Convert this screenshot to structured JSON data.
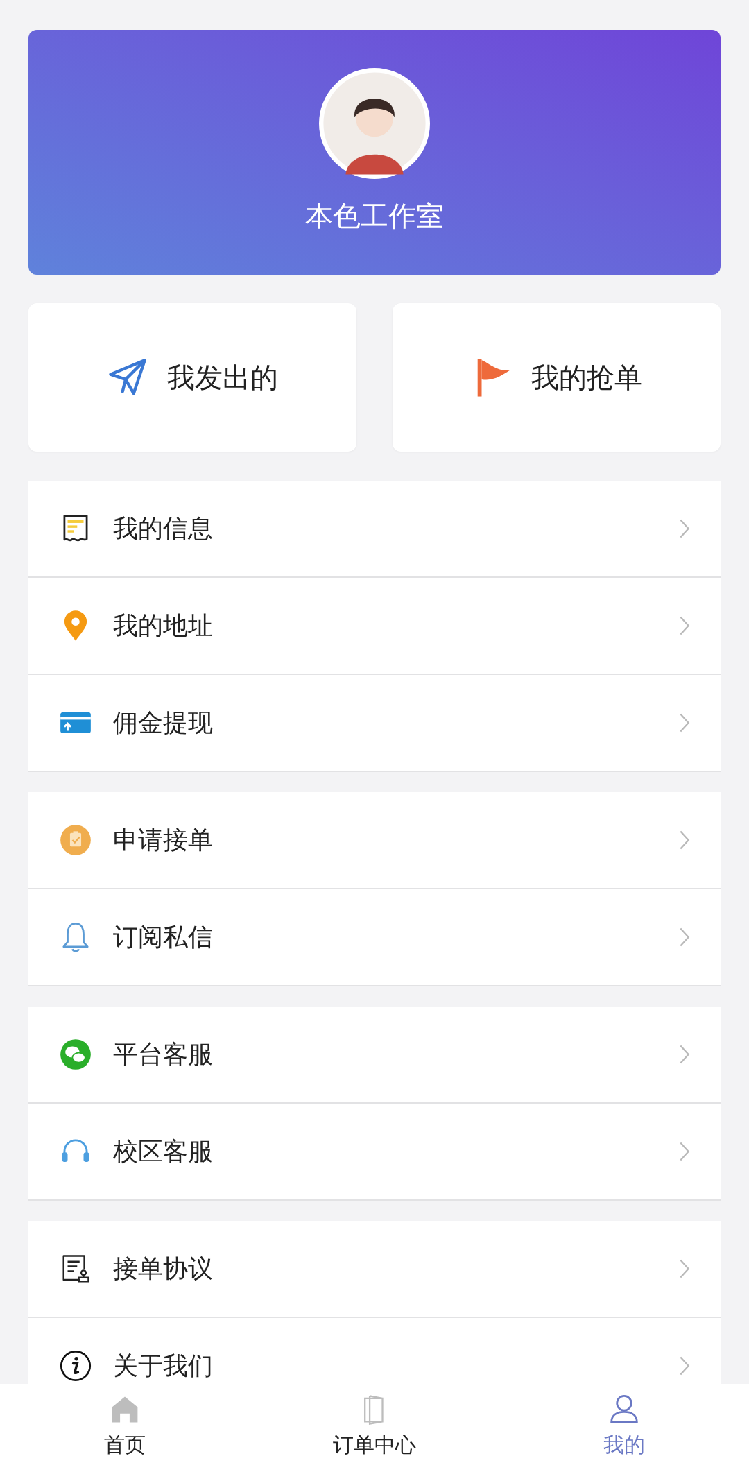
{
  "profile": {
    "name": "本色工作室"
  },
  "actions": [
    {
      "kind": "send",
      "label": "我发出的"
    },
    {
      "kind": "flag",
      "label": "我的抢单"
    }
  ],
  "menu_groups": [
    [
      {
        "kind": "info",
        "label": "我的信息"
      },
      {
        "kind": "location",
        "label": "我的地址"
      },
      {
        "kind": "card",
        "label": "佣金提现"
      }
    ],
    [
      {
        "kind": "apply",
        "label": "申请接单"
      },
      {
        "kind": "bell",
        "label": "订阅私信"
      }
    ],
    [
      {
        "kind": "chat",
        "label": "平台客服"
      },
      {
        "kind": "headset",
        "label": "校区客服"
      }
    ],
    [
      {
        "kind": "agreement",
        "label": "接单协议"
      },
      {
        "kind": "about",
        "label": "关于我们"
      }
    ]
  ],
  "tabs": [
    {
      "kind": "home",
      "label": "首页",
      "selected": false
    },
    {
      "kind": "door",
      "label": "订单中心",
      "selected": false
    },
    {
      "kind": "user",
      "label": "我的",
      "selected": true
    }
  ]
}
